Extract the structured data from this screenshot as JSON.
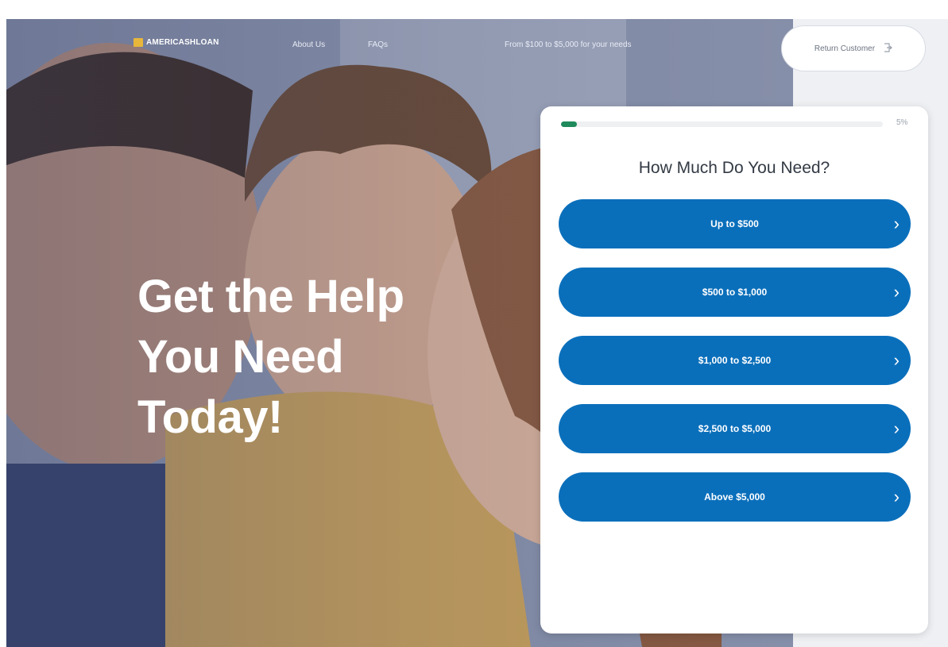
{
  "nav": {
    "logo_text": "AMERICASHLOAN",
    "links": [
      "About Us",
      "FAQs"
    ],
    "tagline": "From $100 to $5,000 for your needs",
    "customer_button": "Return Customer",
    "customer_icon": "login-icon"
  },
  "hero": {
    "headline": [
      "Get the Help",
      "You Need",
      "Today!"
    ]
  },
  "form": {
    "progress": 0.05,
    "progress_text": "5%",
    "title": "How Much Do You Need?",
    "options": [
      "Up to $500",
      "$500 to $1,000",
      "$1,000 to $2,500",
      "$2,500 to $5,000",
      "Above $5,000"
    ],
    "option_icon": "chevron-right-icon"
  },
  "colors": {
    "accent_blue": "#0a6fbb",
    "progress_green": "#1f8a5b",
    "logo_gold": "#e7b63a"
  }
}
